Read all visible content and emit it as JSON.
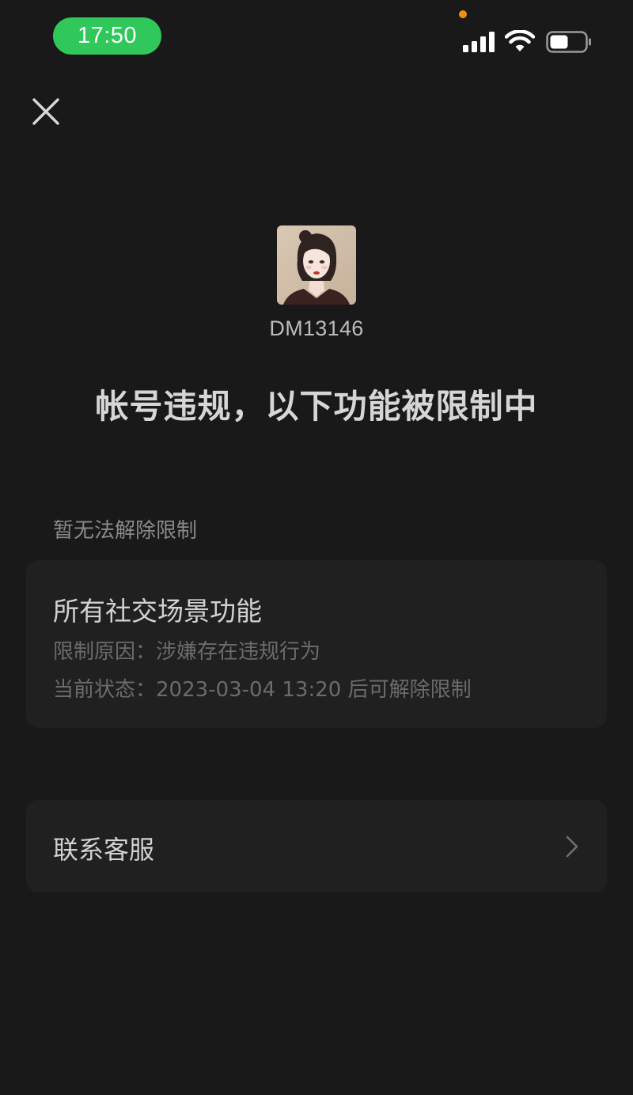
{
  "status_bar": {
    "time": "17:50",
    "time_pill_color": "#30c85a",
    "privacy_dot_color": "#f0900f",
    "icons": [
      "signal-icon",
      "wifi-icon",
      "battery-icon"
    ]
  },
  "header": {
    "close_icon": "close-icon"
  },
  "profile": {
    "avatar_icon": "avatar",
    "username": "DM13146"
  },
  "headline": "帐号违规，以下功能被限制中",
  "section": {
    "label": "暂无法解除限制"
  },
  "restriction": {
    "title": "所有社交场景功能",
    "reason_label": "限制原因：",
    "reason_value": "涉嫌存在违规行为",
    "state_label": "当前状态：",
    "state_value": "2023-03-04 13:20 后可解除限制"
  },
  "contact": {
    "label": "联系客服",
    "chevron_icon": "chevron-right-icon"
  },
  "colors": {
    "background": "#191919",
    "card": "#202020"
  }
}
